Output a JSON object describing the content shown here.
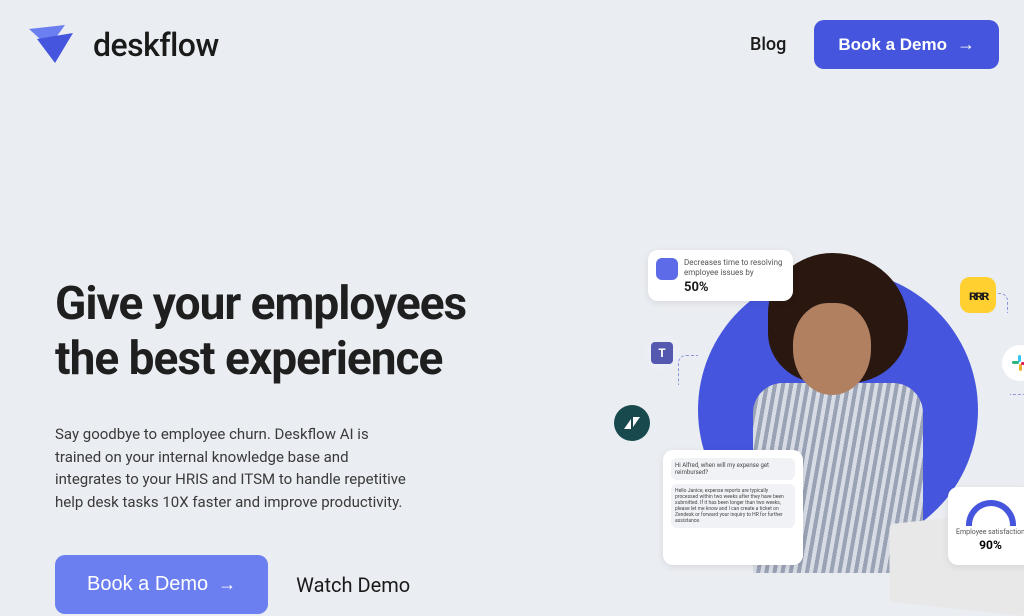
{
  "brand": {
    "name": "deskflow"
  },
  "nav": {
    "blog": "Blog",
    "cta": "Book a Demo"
  },
  "hero": {
    "headline": "Give your employees the best experience",
    "subhead": "Say goodbye to employee churn. Deskflow AI is trained on your internal knowledge base and integrates to your HRIS and ITSM to handle repetitive help desk tasks 10X faster and improve productivity.",
    "cta_primary": "Book a Demo",
    "cta_secondary": "Watch Demo"
  },
  "illustration": {
    "chip_top_label": "Decreases time to resolving employee issues by",
    "chip_top_value": "50%",
    "chip_chat_q": "Hi Alfred, when will my expense get reimbursed?",
    "chip_chat_a": "Hello Janice, expense reports are typically processed within two weeks after they have been submitted. If it has been longer than two weeks, please let me know and I can create a ticket on Zendesk or forward your inquiry to HR for further assistance.",
    "gauge_label": "Employee satisfaction",
    "gauge_value": "90%",
    "icons": {
      "teams": "T",
      "zendesk": "z",
      "miro": "ʀʀʀ",
      "slack": "slack"
    }
  }
}
